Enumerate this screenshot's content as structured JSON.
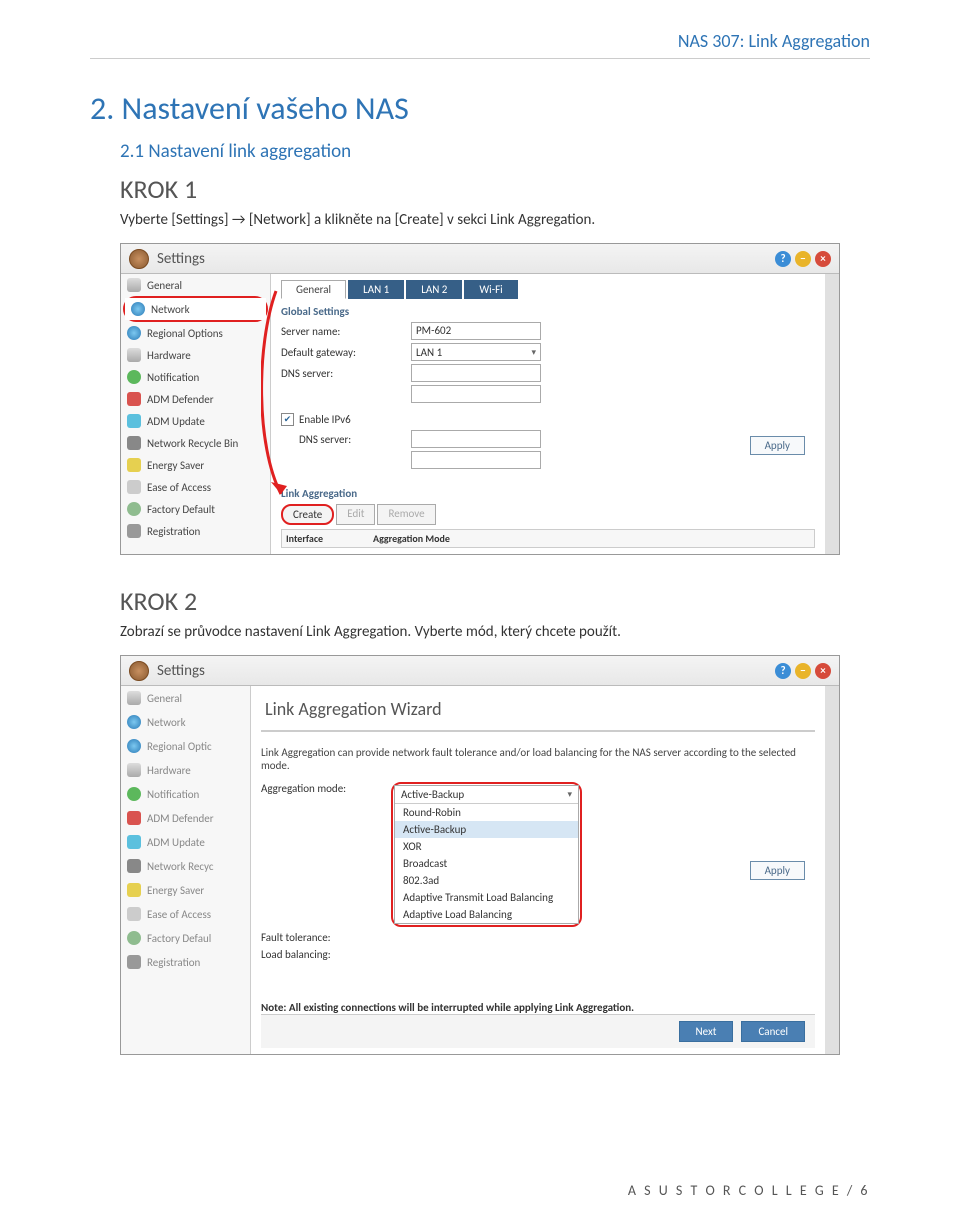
{
  "header": {
    "doc_title": "NAS 307: Link Aggregation"
  },
  "h1": "2.  Nastavení vašeho NAS",
  "h2": "2.1 Nastavení link aggregation",
  "step1": {
    "title": "KROK 1",
    "desc": "Vyberte [Settings] → [Network] a klikněte na [Create] v sekci Link Aggregation."
  },
  "step2": {
    "title": "KROK 2",
    "desc": "Zobrazí se průvodce nastavení Link Aggregation. Vyberte mód, který chcete použít."
  },
  "ss1": {
    "window_title": "Settings",
    "sidebar": [
      "General",
      "Network",
      "Regional Options",
      "Hardware",
      "Notification",
      "ADM Defender",
      "ADM Update",
      "Network Recycle Bin",
      "Energy Saver",
      "Ease of Access",
      "Factory Default",
      "Registration"
    ],
    "tabs": [
      "General",
      "LAN 1",
      "LAN 2",
      "Wi-Fi"
    ],
    "global_settings_h": "Global Settings",
    "server_name_l": "Server name:",
    "server_name_v": "PM-602",
    "gateway_l": "Default gateway:",
    "gateway_v": "LAN 1",
    "dns_l": "DNS server:",
    "ipv6_l": "Enable IPv6",
    "dns2_l": "DNS server:",
    "apply": "Apply",
    "link_agg_h": "Link Aggregation",
    "create": "Create",
    "edit": "Edit",
    "remove": "Remove",
    "iface_h": "Interface",
    "mode_h": "Aggregation Mode"
  },
  "ss2": {
    "window_title": "Settings",
    "sidebar": [
      "General",
      "Network",
      "Regional Optic",
      "Hardware",
      "Notification",
      "ADM Defender",
      "ADM Update",
      "Network Recyc",
      "Energy Saver",
      "Ease of Access",
      "Factory Defaul",
      "Registration"
    ],
    "wizard_title": "Link Aggregation Wizard",
    "wiz_desc": "Link Aggregation can provide network fault tolerance and/or load balancing for the NAS server according to the selected mode.",
    "agg_mode_l": "Aggregation mode:",
    "agg_mode_v": "Active-Backup",
    "options": [
      "Round-Robin",
      "Active-Backup",
      "XOR",
      "Broadcast",
      "802.3ad",
      "Adaptive Transmit Load Balancing",
      "Adaptive Load Balancing"
    ],
    "fault_l": "Fault tolerance:",
    "load_l": "Load balancing:",
    "note": "Note: All existing connections will be interrupted while applying Link Aggregation.",
    "next": "Next",
    "cancel": "Cancel",
    "apply": "Apply"
  },
  "footer": "A S U S T O R   C O L L E G E   /  6"
}
